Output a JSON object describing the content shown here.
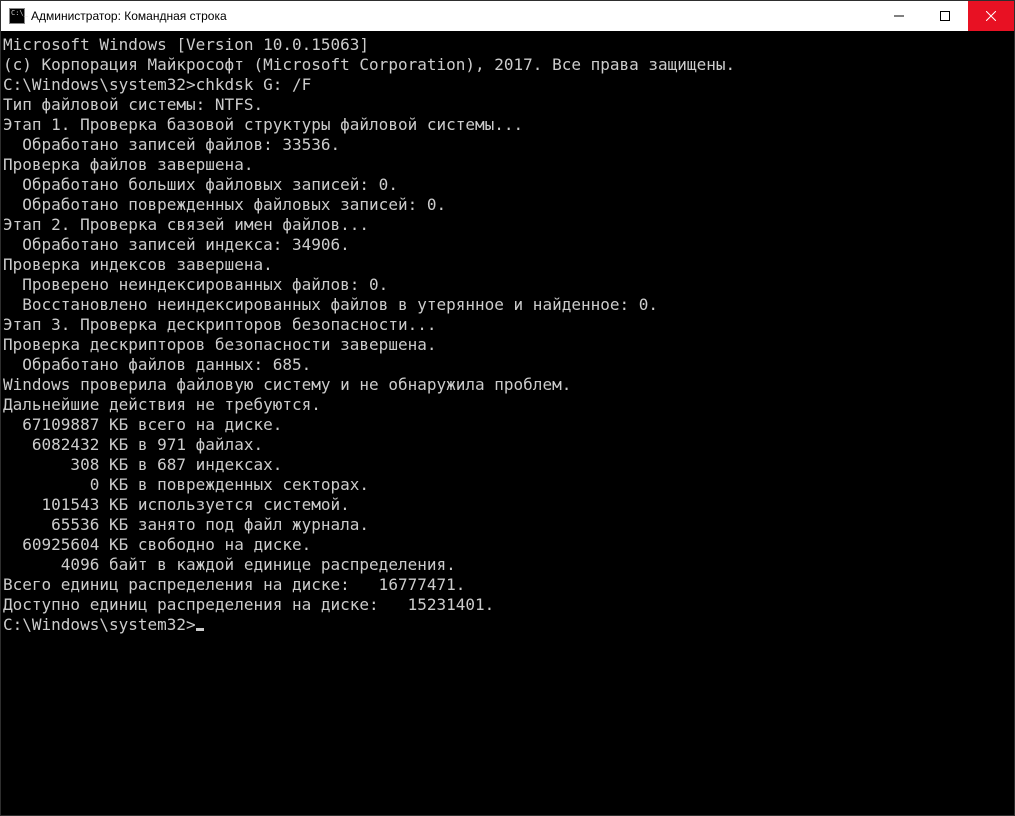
{
  "titlebar": {
    "title": "Администратор: Командная строка"
  },
  "terminal": {
    "prompt1_path": "C:\\Windows\\system32>",
    "prompt1_cmd": "chkdsk G: /F",
    "prompt2_path": "C:\\Windows\\system32>",
    "lines": [
      "Microsoft Windows [Version 10.0.15063]",
      "(c) Корпорация Майкрософт (Microsoft Corporation), 2017. Все права защищены.",
      "",
      "__PROMPT1__",
      "Тип файловой системы: NTFS.",
      "",
      "Этап 1. Проверка базовой структуры файловой системы...",
      "  Обработано записей файлов: 33536.",
      "Проверка файлов завершена.",
      "  Обработано больших файловых записей: 0.",
      "  Обработано поврежденных файловых записей: 0.",
      "",
      "Этап 2. Проверка связей имен файлов...",
      "  Обработано записей индекса: 34906.",
      "Проверка индексов завершена.",
      "  Проверено неиндексированных файлов: 0.",
      "  Восстановлено неиндексированных файлов в утерянное и найденное: 0.",
      "",
      "Этап 3. Проверка дескрипторов безопасности...",
      "Проверка дескрипторов безопасности завершена.",
      "  Обработано файлов данных: 685.",
      "",
      "Windows проверила файловую систему и не обнаружила проблем.",
      "Дальнейшие действия не требуются.",
      "",
      "  67109887 КБ всего на диске.",
      "   6082432 КБ в 971 файлах.",
      "       308 КБ в 687 индексах.",
      "         0 КБ в поврежденных секторах.",
      "    101543 КБ используется системой.",
      "     65536 КБ занято под файл журнала.",
      "  60925604 КБ свободно на диске.",
      "",
      "      4096 байт в каждой единице распределения.",
      "Всего единиц распределения на диске:   16777471.",
      "Доступно единиц распределения на диске:   15231401.",
      ""
    ]
  }
}
